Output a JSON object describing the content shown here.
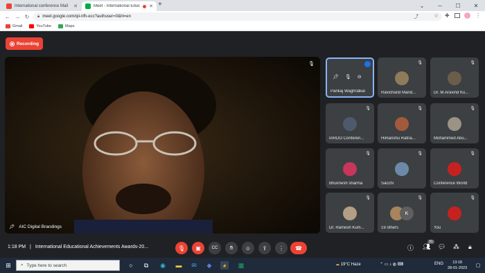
{
  "browser": {
    "tabs": [
      {
        "title": "International conference Mail",
        "favicon_color": "#ea4335",
        "active": false
      },
      {
        "title": "Meet - International Educatio",
        "favicon_color": "#00ac47",
        "active": true
      }
    ],
    "new_tab": "+",
    "url": "meet.google.com/qii-nfh-ecc?authuser=0&hl=en",
    "bookmarks": [
      {
        "label": "Gmail",
        "icon_color": "#ea4335"
      },
      {
        "label": "YouTube",
        "icon_color": "#ff0000"
      },
      {
        "label": "Maps",
        "icon_color": "#34a853"
      }
    ]
  },
  "meet": {
    "recording_label": "Recording",
    "main_speaker": "AIC Digital Brandings",
    "tiles": [
      {
        "name": "Pankaj Waghralkar",
        "active": true,
        "avatar_color": "#3c4043"
      },
      {
        "name": "Ravichand Mand...",
        "active": false,
        "avatar_color": "#8d7b5a"
      },
      {
        "name": "Dr. M.Aravind Ku...",
        "active": false,
        "avatar_color": "#6b5d4a"
      },
      {
        "name": "IARDO Conferen...",
        "active": false,
        "avatar_color": "#4d5a6b"
      },
      {
        "name": "Himanshu Ratna...",
        "active": false,
        "avatar_color": "#a25a3c"
      },
      {
        "name": "Mohammed Abu...",
        "active": false,
        "avatar_color": "#9a9386"
      },
      {
        "name": "Bhuvnesh sharma",
        "active": false,
        "avatar_color": "#c7365b"
      },
      {
        "name": "Sacchi",
        "active": false,
        "avatar_color": "#6c8aa8"
      },
      {
        "name": "Conference World",
        "active": false,
        "avatar_color": "#c5221f"
      },
      {
        "name": "Dr. Ramesh Kum...",
        "active": false,
        "avatar_color": "#b39f85"
      },
      {
        "name": "19 others",
        "active": false,
        "avatar_color": "#5f5f5f",
        "initial": "K"
      },
      {
        "name": "You",
        "active": false,
        "avatar_color": "#c5221f"
      }
    ],
    "time": "1:18 PM",
    "separator": "|",
    "meeting_title": "International Educational Achievements Awards-20...",
    "people_count": "31"
  },
  "taskbar": {
    "search_placeholder": "Type here to search",
    "weather": "19°C  Haze",
    "lang": "ENG",
    "clock_time": "13:18",
    "clock_date": "28-01-2023"
  }
}
